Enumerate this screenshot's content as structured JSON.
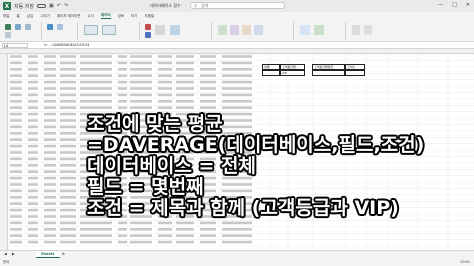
{
  "titlebar": {
    "app_icon": "excel-logo",
    "app_letter": "X",
    "autosave": "자동 저장",
    "document_title": "데이터베이스 함수",
    "search_placeholder": "검색",
    "window_controls": [
      "—",
      "□",
      "✕"
    ]
  },
  "ribbon": {
    "tabs": [
      "파일",
      "홈",
      "삽입",
      "그리기",
      "페이지 레이아웃",
      "수식",
      "데이터",
      "검토",
      "보기",
      "도움말"
    ],
    "active_tab": "데이터"
  },
  "formula_bar": {
    "name_box": "L4",
    "fx": "fx",
    "formula": "=DAVERAGE(A3:H134"
  },
  "sheet": {
    "name_prefixes": [
      "오지석",
      "김우성",
      "한예주",
      "김민호",
      "김재형",
      "김지현",
      "박성윤",
      "최은영",
      "이정민",
      "박하늘",
      "김민석",
      "박해진",
      "오재경",
      "이규호",
      "이경민",
      "이재혁",
      "정신희",
      "김희정",
      "김가람",
      "박민주",
      "정진욱",
      "최서우",
      "김나래",
      "김윤성",
      "박채은",
      "김선유",
      "박나래",
      "이민식",
      "김정수"
    ],
    "criteria_headers": [
      "성별",
      "고객등급별 ...",
      "고객등급별평균",
      "고객수"
    ],
    "criteria_values": [
      "",
      "VIP",
      "",
      ""
    ]
  },
  "overlay": {
    "line1": "조건에 맞는 평균",
    "line2": "=DAVERAGE(데이터베이스,필드,조건)",
    "line3": "데이터베이스 = 전체",
    "line4": "필드 = 몇번째",
    "line5": "조건 = 제목과 함께 (고객등급과 VIP)"
  },
  "footer": {
    "sheet_tab": "Sheet1",
    "status": "준비",
    "zoom": "100%"
  }
}
